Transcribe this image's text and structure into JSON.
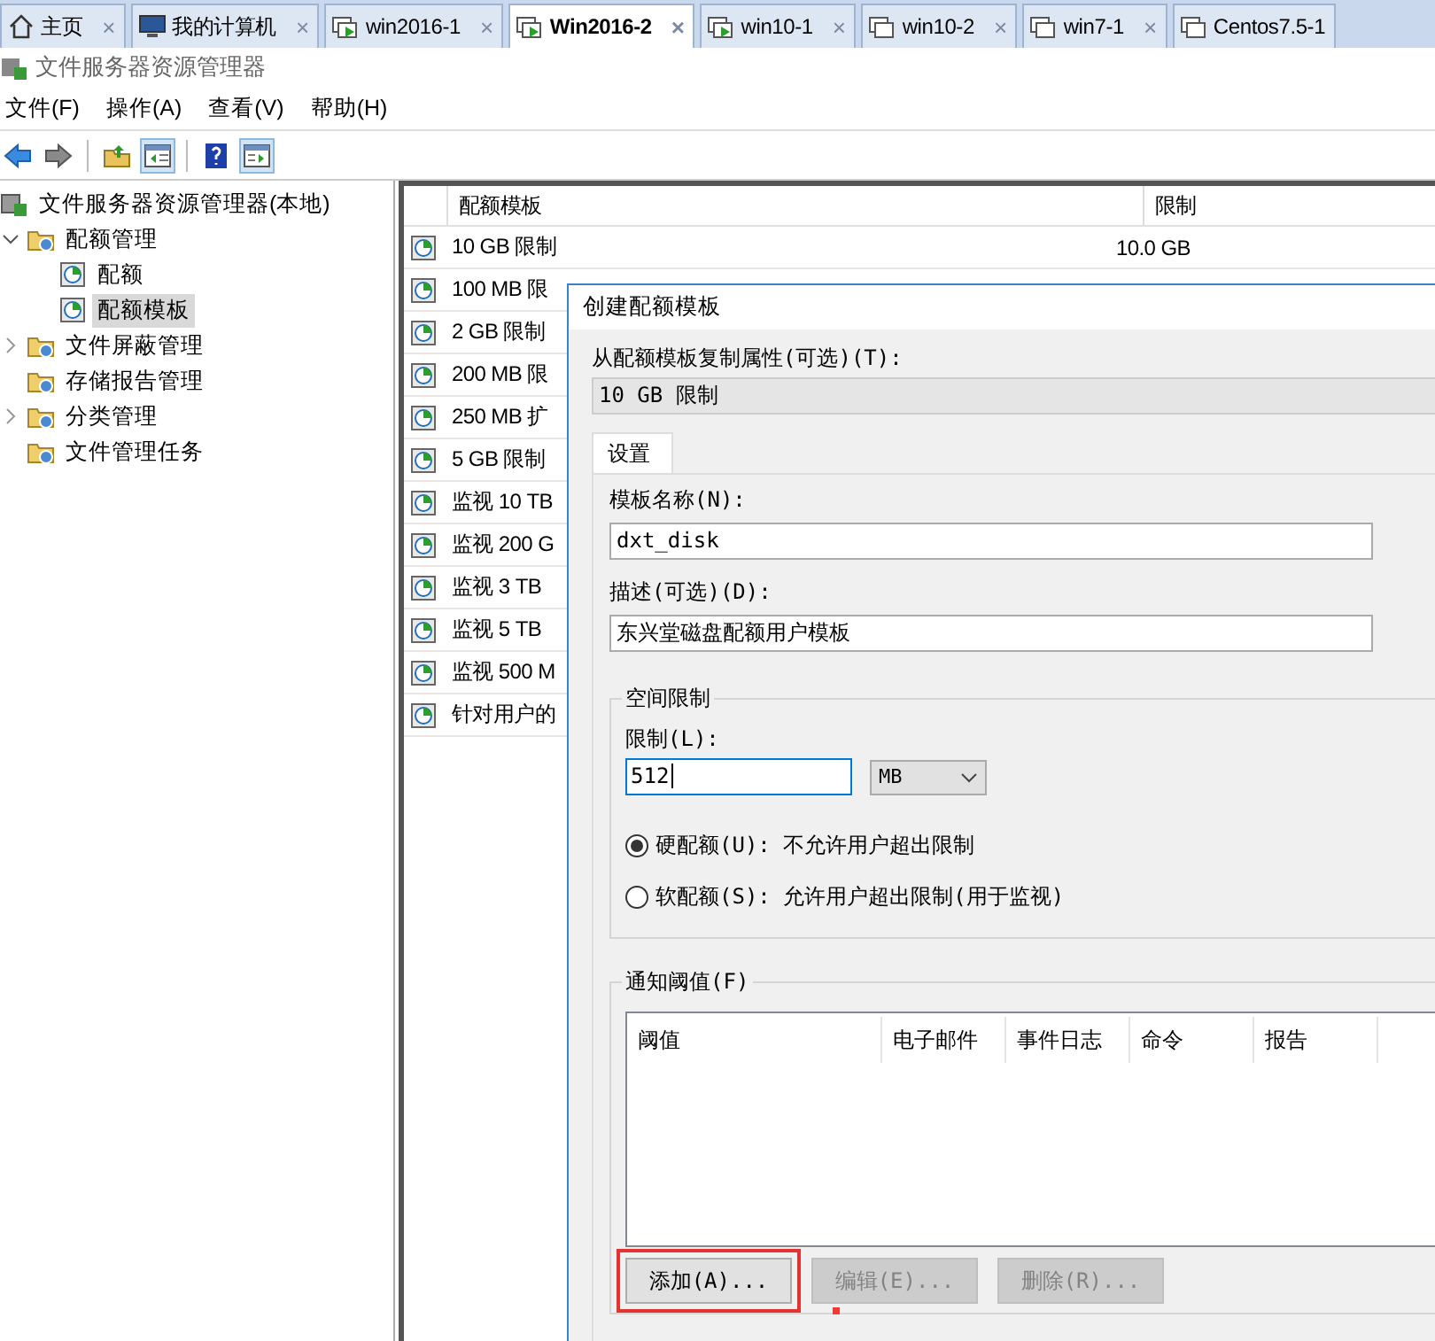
{
  "browser_tabs": [
    {
      "label": "主页",
      "kind": "home",
      "selected": false,
      "close": "×"
    },
    {
      "label": "我的计算机",
      "kind": "computer",
      "selected": false,
      "close": "×"
    },
    {
      "label": "win2016-1",
      "kind": "vm-running",
      "selected": false,
      "close": "×"
    },
    {
      "label": "Win2016-2",
      "kind": "vm-running",
      "selected": true,
      "close": "×"
    },
    {
      "label": "win10-1",
      "kind": "vm-running",
      "selected": false,
      "close": "×"
    },
    {
      "label": "win10-2",
      "kind": "vm",
      "selected": false,
      "close": "×"
    },
    {
      "label": "win7-1",
      "kind": "vm",
      "selected": false,
      "close": "×"
    },
    {
      "label": "Centos7.5-1",
      "kind": "vm",
      "selected": false
    }
  ],
  "window": {
    "title": "文件服务器资源管理器"
  },
  "menu": [
    "文件(F)",
    "操作(A)",
    "查看(V)",
    "帮助(H)"
  ],
  "toolbar": [
    {
      "kind": "back",
      "pressed": false
    },
    {
      "kind": "forward",
      "pressed": false
    },
    {
      "kind": "up",
      "pressed": false
    },
    {
      "kind": "tree-pane",
      "pressed": true
    },
    {
      "kind": "help",
      "pressed": false
    },
    {
      "kind": "action-pane",
      "pressed": true
    }
  ],
  "tree": {
    "label": "文件服务器资源管理器(本地)",
    "children": [
      {
        "label": "配额管理",
        "expanded": true,
        "selected": false,
        "children": [
          {
            "label": "配额",
            "selected": false
          },
          {
            "label": "配额模板",
            "selected": true
          }
        ]
      },
      {
        "label": "文件屏蔽管理",
        "expanded": false,
        "selected": false
      },
      {
        "label": "存储报告管理",
        "selected": false
      },
      {
        "label": "分类管理",
        "expanded": false,
        "selected": false
      },
      {
        "label": "文件管理任务",
        "selected": false
      }
    ]
  },
  "list": {
    "columns": [
      "配额模板",
      "限制"
    ],
    "rows": [
      {
        "name": "10 GB 限制",
        "limit": "10.0 GB"
      },
      {
        "name": "100 MB 限"
      },
      {
        "name": "2 GB 限制"
      },
      {
        "name": "200 MB 限"
      },
      {
        "name": "250 MB 扩"
      },
      {
        "name": "5 GB 限制"
      },
      {
        "name": "监视 10 TB"
      },
      {
        "name": "监视 200 G"
      },
      {
        "name": "监视 3 TB"
      },
      {
        "name": "监视 5 TB"
      },
      {
        "name": "监视 500 M"
      },
      {
        "name": "针对用户的"
      }
    ]
  },
  "dialog": {
    "title": "创建配额模板",
    "copy_label": "从配额模板复制属性(可选)(T):",
    "copy_value": "10 GB 限制",
    "tabs": [
      {
        "label": "设置",
        "selected": true
      }
    ],
    "name_label": "模板名称(N):",
    "name_value": "dxt_disk",
    "desc_label": "描述(可选)(D):",
    "desc_value": "东兴堂磁盘配额用户模板",
    "space_group": "空间限制",
    "limit_label": "限制(L):",
    "limit_value": "512",
    "unit": "MB",
    "quota_types": [
      {
        "label": "硬配额(U): 不允许用户超出限制",
        "selected": true
      },
      {
        "label": "软配额(S): 允许用户超出限制(用于监视)",
        "selected": false
      }
    ],
    "notify_group": "通知阈值(F)",
    "notify_columns": [
      "阈值",
      "电子邮件",
      "事件日志",
      "命令",
      "报告"
    ],
    "buttons": [
      {
        "label": "添加(A)...",
        "disabled": false,
        "highlighted": true
      },
      {
        "label": "编辑(E)...",
        "disabled": true,
        "highlighted": false
      },
      {
        "label": "删除(R)...",
        "disabled": true,
        "highlighted": false
      }
    ]
  }
}
